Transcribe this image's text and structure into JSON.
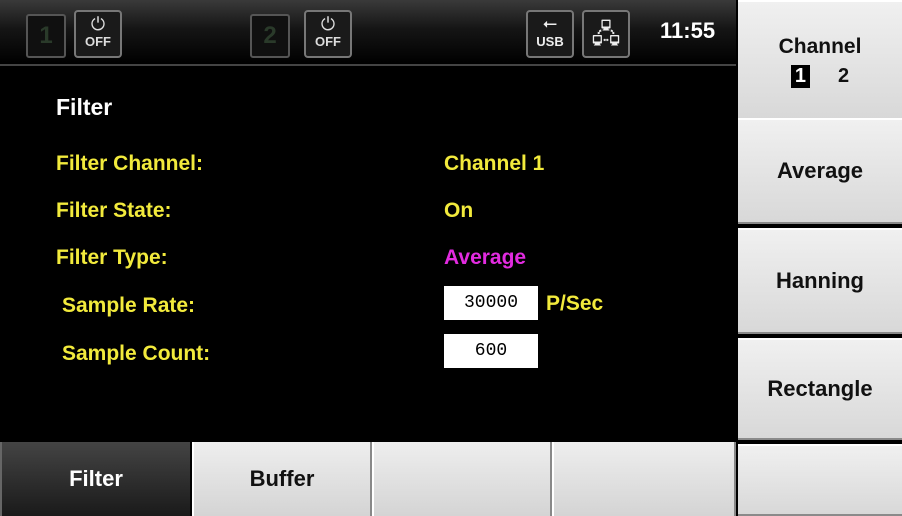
{
  "status_bar": {
    "channel1": "1",
    "channel2": "2",
    "power1": {
      "symbol": "⏻",
      "text": "OFF"
    },
    "power2": {
      "symbol": "⏻",
      "text": "OFF"
    },
    "usb": {
      "symbol": "⭠",
      "text": "USB"
    },
    "network_symbol": "🖧",
    "clock": "11:55"
  },
  "main": {
    "title": "Filter",
    "rows": [
      {
        "label": "Filter Channel:",
        "value": "Channel 1",
        "value_color": "#f2ea3c"
      },
      {
        "label": "Filter State:",
        "value": "On",
        "value_color": "#f2ea3c"
      },
      {
        "label": "Filter Type:",
        "value": "Average",
        "value_color": "#e22be0"
      },
      {
        "label": "Sample Rate:",
        "value": "30000",
        "unit": "P/Sec"
      },
      {
        "label": "Sample Count:",
        "value": "600"
      }
    ]
  },
  "softkeys_right": {
    "channel": {
      "label": "Channel",
      "options": [
        "1",
        "2"
      ],
      "selected": "1"
    },
    "average": "Average",
    "hanning": "Hanning",
    "rectangle": "Rectangle"
  },
  "softkeys_bottom": [
    "Filter",
    "Buffer",
    "",
    "",
    ""
  ]
}
